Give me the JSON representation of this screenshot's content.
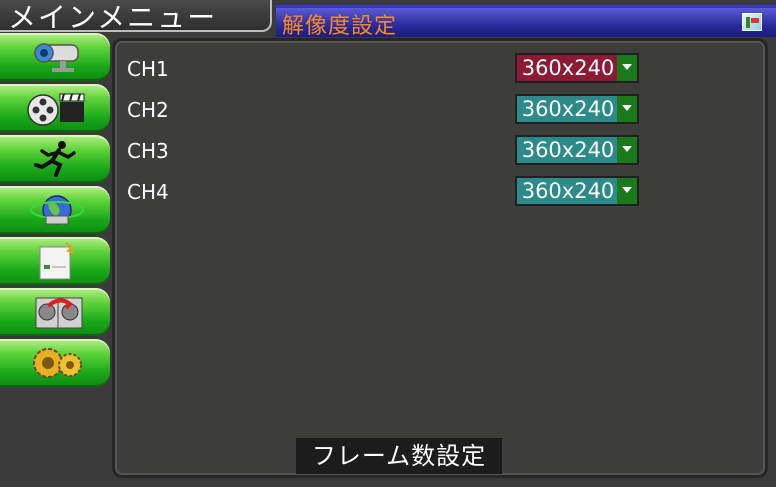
{
  "main_menu": {
    "title": "メインメニュー"
  },
  "page": {
    "title": "解像度設定",
    "flag_icon": "flag-icon"
  },
  "sidebar": {
    "items": [
      {
        "icon": "camera-icon"
      },
      {
        "icon": "playback-icon"
      },
      {
        "icon": "motion-icon"
      },
      {
        "icon": "network-icon"
      },
      {
        "icon": "document-icon"
      },
      {
        "icon": "disk-icon"
      },
      {
        "icon": "settings-icon"
      }
    ]
  },
  "channels": [
    {
      "label": "CH1",
      "resolution": "360x240",
      "active": true
    },
    {
      "label": "CH2",
      "resolution": "360x240",
      "active": false
    },
    {
      "label": "CH3",
      "resolution": "360x240",
      "active": false
    },
    {
      "label": "CH4",
      "resolution": "360x240",
      "active": false
    }
  ],
  "footer": {
    "frame_button_label": "フレーム数設定"
  },
  "colors": {
    "active_select": "#8c1a35",
    "select_bg": "#2c8a8a",
    "sidebar_green": "#19a81a",
    "title_orange": "#ff8a1a"
  }
}
